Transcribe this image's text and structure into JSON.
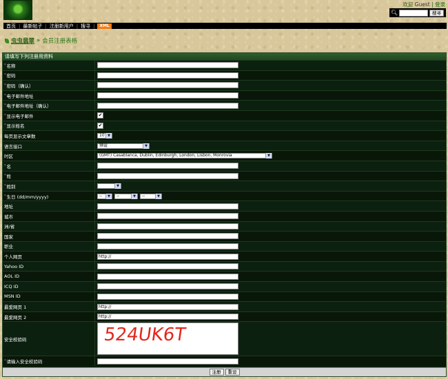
{
  "header": {
    "welcome_text": "欢迎",
    "guest": "Guest",
    "separator": "|",
    "login_link": "登录",
    "search_button": "搜寻",
    "search_value": ""
  },
  "nav": {
    "items": [
      "首页",
      "最新帖子",
      "注册新用户",
      "搜寻"
    ],
    "xml_badge": "XML"
  },
  "breadcrumb": {
    "forum": "虫虫翡翠",
    "separator": "»",
    "current": "会员注册表格"
  },
  "form": {
    "header": "请填写下列注册用资料",
    "fields": [
      {
        "label": "名称",
        "type": "text",
        "value": "",
        "required": true
      },
      {
        "label": "密码",
        "type": "text",
        "value": "",
        "required": true
      },
      {
        "label": "密码（确认）",
        "type": "text",
        "value": "",
        "required": true
      },
      {
        "label": "电子邮件地址",
        "type": "text",
        "value": "",
        "required": true
      },
      {
        "label": "电子邮件地址（确认）",
        "type": "text",
        "value": "",
        "required": true
      },
      {
        "label": "显示电子邮件",
        "type": "checkbox",
        "checked": true,
        "required": true
      },
      {
        "label": "显示姓名",
        "type": "checkbox",
        "checked": true,
        "required": true
      },
      {
        "label": "每页显示文章数",
        "type": "select",
        "value": "10",
        "width": 22,
        "required": false
      },
      {
        "label": "语言接口",
        "type": "select",
        "value": "预设",
        "width": 76,
        "required": false
      },
      {
        "label": "时区",
        "type": "select",
        "value": "(GMT) Casablanca, Dublin, Edinburgh, London, Lisbon, Monrovia",
        "width": 254,
        "required": false
      },
      {
        "label": "名",
        "type": "text",
        "value": "",
        "required": true
      },
      {
        "label": "姓",
        "type": "text",
        "value": "",
        "required": true
      },
      {
        "label": "姓别",
        "type": "select",
        "value": "",
        "width": 35,
        "required": true
      },
      {
        "label": "生日 (dd/mm/yyyy)",
        "type": "date",
        "day": "--",
        "month": "--",
        "year": "--",
        "required": true
      },
      {
        "label": "地址",
        "type": "text",
        "value": "",
        "required": false
      },
      {
        "label": "城市",
        "type": "text",
        "value": "",
        "required": false
      },
      {
        "label": "洲/省",
        "type": "text",
        "value": "",
        "required": false
      },
      {
        "label": "国家",
        "type": "text",
        "value": "",
        "required": false
      },
      {
        "label": "职业",
        "type": "text",
        "value": "",
        "required": false
      },
      {
        "label": "个人网页",
        "type": "text",
        "value": "http://",
        "required": false
      },
      {
        "label": "Yahoo ID",
        "type": "text",
        "value": "",
        "required": false
      },
      {
        "label": "AOL ID",
        "type": "text",
        "value": "",
        "required": false
      },
      {
        "label": "ICQ ID",
        "type": "text",
        "value": "",
        "required": false
      },
      {
        "label": "MSN ID",
        "type": "text",
        "value": "",
        "required": false
      },
      {
        "label": "最爱网页 1",
        "type": "text",
        "value": "http://",
        "required": false
      },
      {
        "label": "最爱网页 2",
        "type": "text",
        "value": "http://",
        "required": false
      },
      {
        "label": "安全校验码",
        "type": "captcha",
        "value": "524UK6T",
        "required": false
      },
      {
        "label": "请输入安全校验码",
        "type": "text",
        "value": "",
        "required": true
      }
    ],
    "submit_label": "注册",
    "reset_label": "重设"
  },
  "colors": {
    "background": "#d8c79a",
    "form_bg": "#0a1c0a",
    "header_green": "#2e5e2e",
    "link_green": "#225e12",
    "xml_orange": "#f27d18",
    "captcha_red": "#e2281d"
  },
  "icons": {
    "search": "search-icon",
    "breadcrumb": "leaf-icon"
  }
}
